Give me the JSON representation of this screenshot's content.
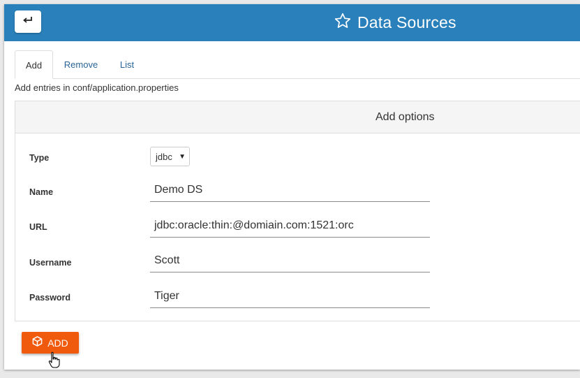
{
  "header": {
    "title": "Data Sources",
    "back_icon": "back-arrow-icon",
    "title_icon": "star-icon",
    "color": "#2a80ba"
  },
  "tabs": [
    {
      "label": "Add",
      "active": true
    },
    {
      "label": "Remove",
      "active": false
    },
    {
      "label": "List",
      "active": false
    }
  ],
  "hint": "Add entries in conf/application.properties",
  "panel": {
    "title": "Add options"
  },
  "form": {
    "type": {
      "label": "Type",
      "value": "jdbc"
    },
    "name": {
      "label": "Name",
      "value": "Demo DS"
    },
    "url": {
      "label": "URL",
      "value": "jdbc:oracle:thin:@domiain.com:1521:orc"
    },
    "username": {
      "label": "Username",
      "value": "Scott"
    },
    "password": {
      "label": "Password",
      "value": "Tiger"
    }
  },
  "add_button": {
    "label": "ADD",
    "icon": "cube-icon",
    "color": "#f05a0d"
  }
}
